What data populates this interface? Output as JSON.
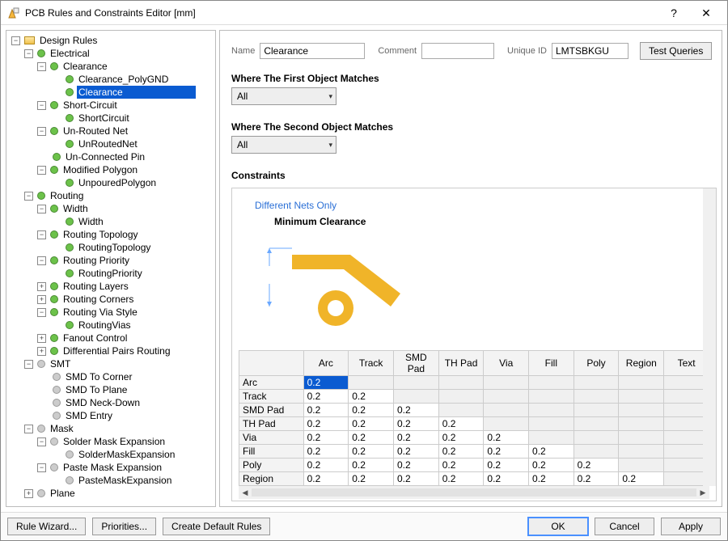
{
  "window": {
    "title": "PCB Rules and Constraints Editor [mm]"
  },
  "titlebar": {
    "help": "?",
    "close": "✕"
  },
  "tree": {
    "root": "Design Rules",
    "electrical": "Electrical",
    "clearance": "Clearance",
    "clearance_poly": "Clearance_PolyGND",
    "clearance_sel": "Clearance",
    "short": "Short-Circuit",
    "short_child": "ShortCircuit",
    "unrouted": "Un-Routed Net",
    "unrouted_child": "UnRoutedNet",
    "uncon": "Un-Connected Pin",
    "modpoly": "Modified Polygon",
    "unpoured": "UnpouredPolygon",
    "routing": "Routing",
    "width": "Width",
    "width_child": "Width",
    "rtopo": "Routing Topology",
    "rtopo_child": "RoutingTopology",
    "rprio": "Routing Priority",
    "rprio_child": "RoutingPriority",
    "rlayers": "Routing Layers",
    "rcorners": "Routing Corners",
    "rvia": "Routing Via Style",
    "rvia_child": "RoutingVias",
    "fanout": "Fanout Control",
    "diffpairs": "Differential Pairs Routing",
    "smt": "SMT",
    "smt_corner": "SMD To Corner",
    "smt_plane": "SMD To Plane",
    "smt_neck": "SMD Neck-Down",
    "smt_entry": "SMD Entry",
    "mask": "Mask",
    "solder_exp": "Solder Mask Expansion",
    "solder_exp_child": "SolderMaskExpansion",
    "paste_exp": "Paste Mask Expansion",
    "paste_exp_child": "PasteMaskExpansion",
    "plane": "Plane"
  },
  "form": {
    "name_lbl": "Name",
    "name_val": "Clearance",
    "comment_lbl": "Comment",
    "comment_val": "",
    "uid_lbl": "Unique ID",
    "uid_val": "LMTSBKGU",
    "test_btn": "Test Queries",
    "first_lbl": "Where The First Object Matches",
    "second_lbl": "Where The Second Object Matches",
    "all": "All",
    "constraints_lbl": "Constraints"
  },
  "diagram": {
    "diff": "Different Nets Only",
    "min": "Minimum Clearance"
  },
  "chart_data": {
    "type": "table",
    "title": "Minimum Clearance matrix (mm)",
    "columns": [
      "Arc",
      "Track",
      "SMD Pad",
      "TH Pad",
      "Via",
      "Fill",
      "Poly",
      "Region",
      "Text"
    ],
    "rows": [
      "Arc",
      "Track",
      "SMD Pad",
      "TH Pad",
      "Via",
      "Fill",
      "Poly",
      "Region"
    ],
    "values": [
      [
        0.2,
        null,
        null,
        null,
        null,
        null,
        null,
        null,
        null
      ],
      [
        0.2,
        0.2,
        null,
        null,
        null,
        null,
        null,
        null,
        null
      ],
      [
        0.2,
        0.2,
        0.2,
        null,
        null,
        null,
        null,
        null,
        null
      ],
      [
        0.2,
        0.2,
        0.2,
        0.2,
        null,
        null,
        null,
        null,
        null
      ],
      [
        0.2,
        0.2,
        0.2,
        0.2,
        0.2,
        null,
        null,
        null,
        null
      ],
      [
        0.2,
        0.2,
        0.2,
        0.2,
        0.2,
        0.2,
        null,
        null,
        null
      ],
      [
        0.2,
        0.2,
        0.2,
        0.2,
        0.2,
        0.2,
        0.2,
        null,
        null
      ],
      [
        0.2,
        0.2,
        0.2,
        0.2,
        0.2,
        0.2,
        0.2,
        0.2,
        null
      ]
    ],
    "selected": [
      0,
      0
    ]
  },
  "footer": {
    "wizard": "Rule Wizard...",
    "prio": "Priorities...",
    "defrules": "Create Default Rules",
    "ok": "OK",
    "cancel": "Cancel",
    "apply": "Apply"
  }
}
